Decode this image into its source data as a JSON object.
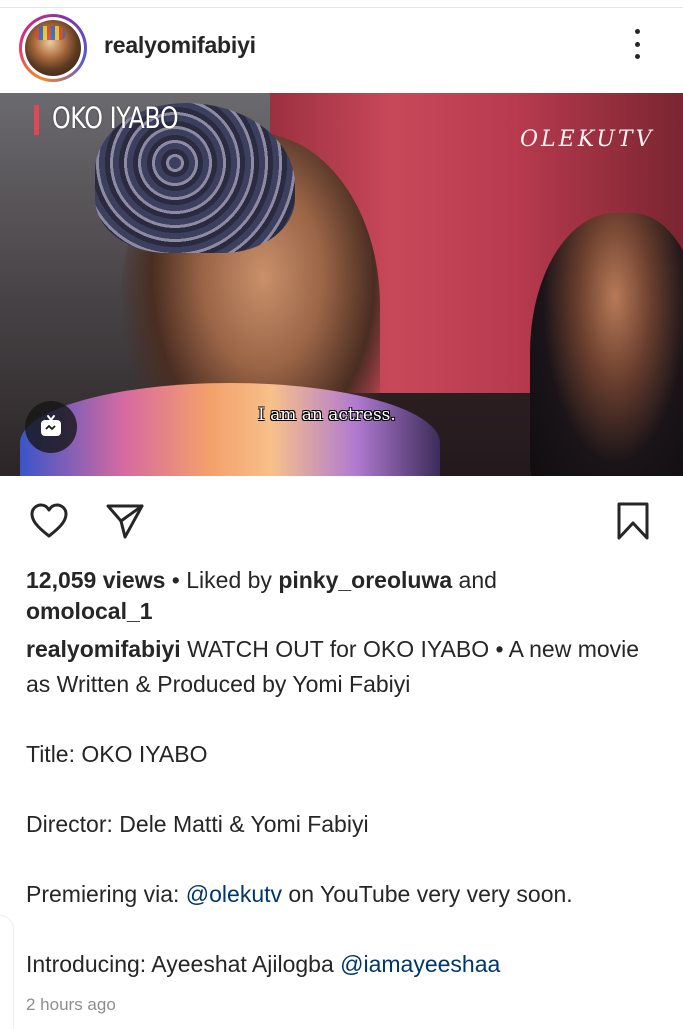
{
  "post": {
    "username": "realyomifabiyi",
    "media": {
      "title_overlay": "OKO IYABO",
      "watermark": "OLEKUTV",
      "subtitle": "I am an actress."
    },
    "stats": {
      "views": "12,059 views",
      "liked_by_prefix": "Liked by",
      "liked_user_1": "pinky_oreoluwa",
      "and": "and",
      "liked_user_2": "omolocal_1"
    },
    "caption": {
      "username": "realyomifabiyi",
      "line1": "WATCH OUT for OKO IYABO • A new movie as Written & Produced by Yomi Fabiyi",
      "title_line": "Title: OKO IYABO",
      "director_line": "Director: Dele Matti & Yomi Fabiyi",
      "premiering_prefix": "Premiering via:",
      "premiering_mention": "@olekutv",
      "premiering_suffix": "on YouTube very very soon.",
      "introducing_prefix": "Introducing: Ayeeshat Ajilogba",
      "introducing_mention": "@iamayeeshaa"
    },
    "timestamp": "2 hours ago"
  },
  "icons": {
    "more": "more-vertical-icon",
    "like": "heart-icon",
    "share": "send-icon",
    "save": "bookmark-icon",
    "igtv": "igtv-icon"
  },
  "colors": {
    "text": "#262626",
    "mention": "#00376b",
    "muted": "#8e8e8e",
    "title_accent": "#e04858"
  }
}
